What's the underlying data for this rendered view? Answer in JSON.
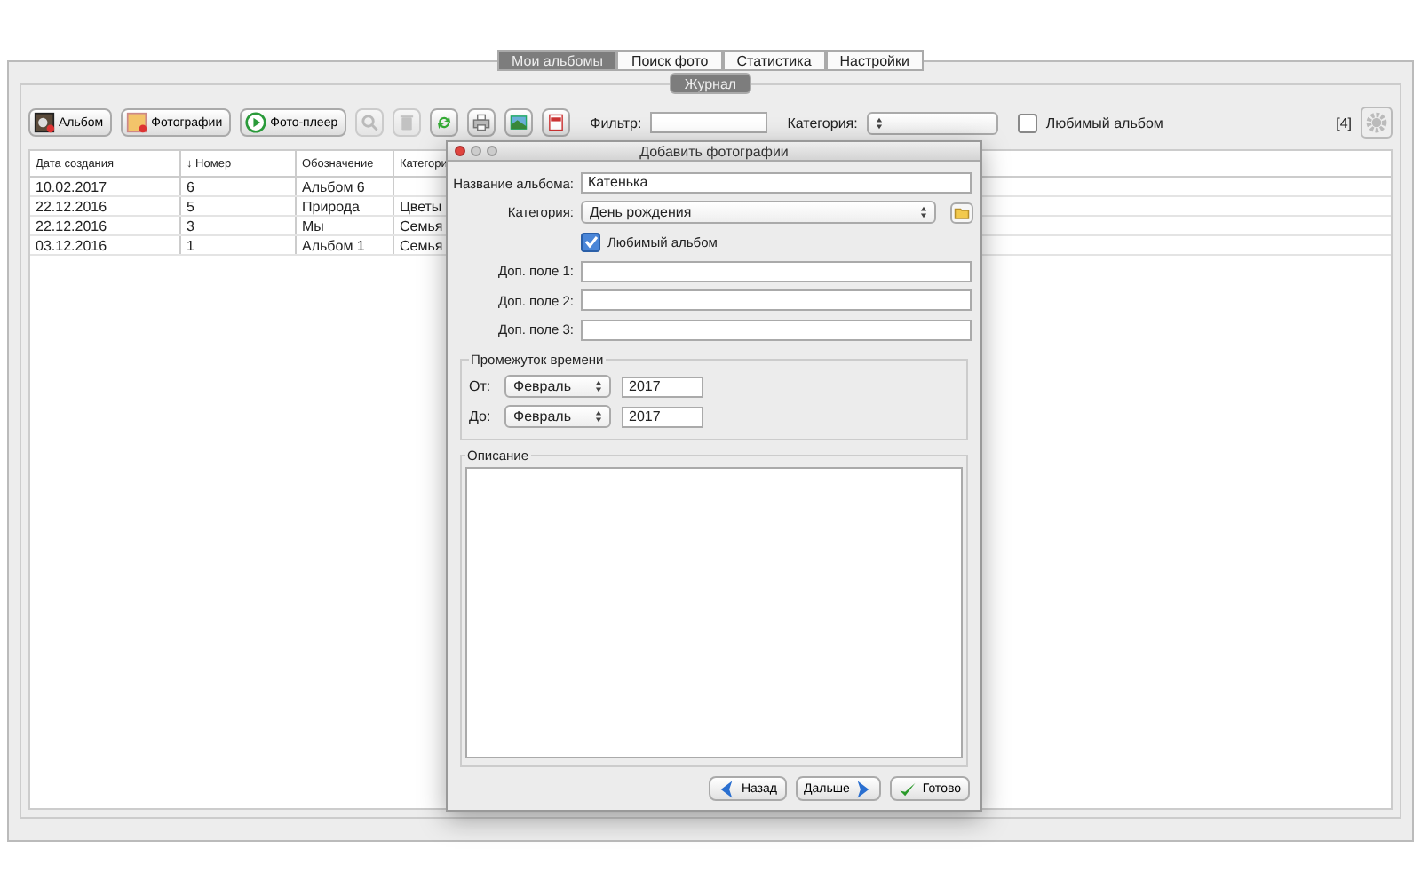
{
  "tabs": [
    {
      "label": "Мои альбомы",
      "selected": true
    },
    {
      "label": "Поиск фото",
      "selected": false
    },
    {
      "label": "Статистика",
      "selected": false
    },
    {
      "label": "Настройки",
      "selected": false
    }
  ],
  "subtabs": [
    {
      "label": "Журнал",
      "selected": true
    }
  ],
  "toolbar": {
    "buttons": [
      {
        "kind": "album",
        "label": "Альбом"
      },
      {
        "kind": "photos",
        "label": "Фотографии"
      },
      {
        "kind": "player",
        "label": "Фото-плеер"
      }
    ],
    "icon_buttons": [
      {
        "kind": "search",
        "disabled": true
      },
      {
        "kind": "trash",
        "disabled": true
      },
      {
        "kind": "refresh",
        "disabled": false
      },
      {
        "kind": "print",
        "disabled": false
      },
      {
        "kind": "export",
        "disabled": false
      },
      {
        "kind": "pdf",
        "disabled": false
      }
    ],
    "filter_label": "Фильтр:",
    "category_label": "Категория:",
    "favorite": {
      "label": "Любимый альбом",
      "checked": false
    },
    "count": "[4]"
  },
  "table": {
    "columns": [
      "Дата создания",
      "↓ Номер",
      "Обозначение",
      "Категори"
    ],
    "rows": [
      [
        "10.02.2017",
        "6",
        "Альбом 6",
        ""
      ],
      [
        "22.12.2016",
        "5",
        "Природа",
        "Цветы"
      ],
      [
        "22.12.2016",
        "3",
        "Мы",
        "Семья"
      ],
      [
        "03.12.2016",
        "1",
        "Альбом 1",
        "Семья"
      ]
    ]
  },
  "dialog": {
    "title": "Добавить фотографии",
    "album_name": {
      "label": "Название альбома:",
      "value": "Катенька"
    },
    "category": {
      "label": "Категория:",
      "value": "День рождения"
    },
    "favorite": {
      "label": "Любимый альбом",
      "checked": true
    },
    "extra_fields": [
      {
        "label": "Доп. поле 1:"
      },
      {
        "label": "Доп. поле 2:"
      },
      {
        "label": "Доп. поле 3:"
      }
    ],
    "period": {
      "title": "Промежуток времени",
      "rows": [
        {
          "label": "От:",
          "month": "Февраль",
          "year": "2017"
        },
        {
          "label": "До:",
          "month": "Февраль",
          "year": "2017"
        }
      ]
    },
    "description": {
      "title": "Описание"
    },
    "buttons": [
      {
        "kind": "back",
        "label": "Назад"
      },
      {
        "kind": "next",
        "label": "Дальше"
      },
      {
        "kind": "done",
        "label": "Готово"
      }
    ]
  }
}
